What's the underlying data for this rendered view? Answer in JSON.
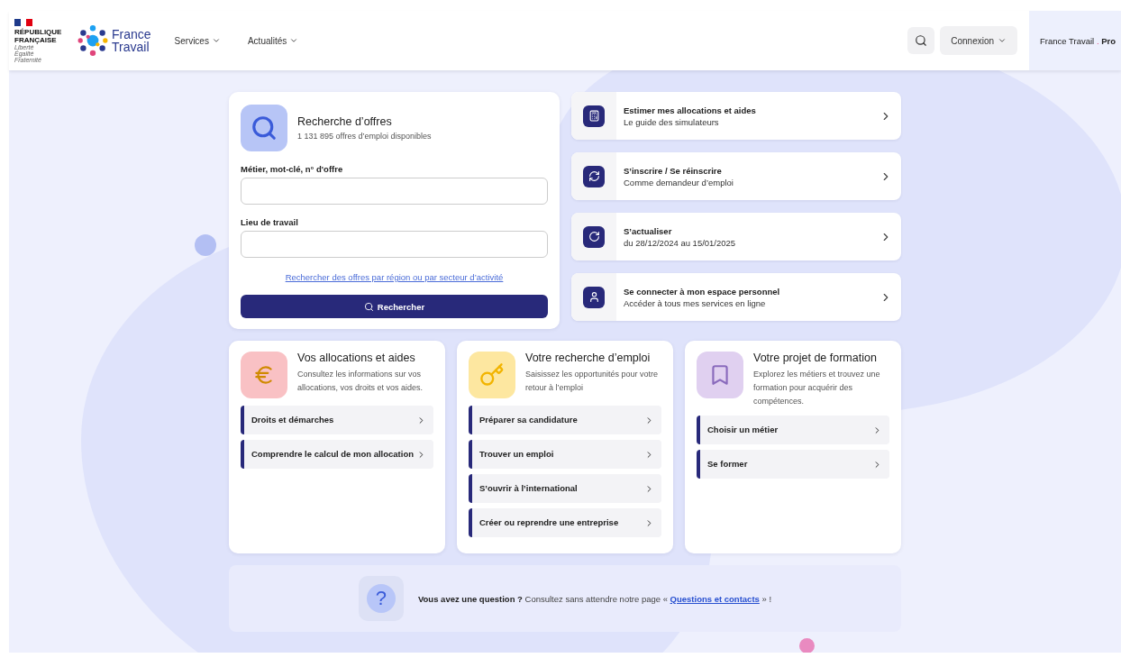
{
  "header": {
    "republic": {
      "line1": "RÉPUBLIQUE",
      "line2": "FRANÇAISE",
      "motto": [
        "Liberté",
        "Égalité",
        "Fraternité"
      ]
    },
    "brand": {
      "line1": "France",
      "line2": "Travail"
    },
    "nav": [
      {
        "label": "Services"
      },
      {
        "label": "Actualités"
      }
    ],
    "login": {
      "label": "Connexion"
    },
    "pro": {
      "name": "France Travail",
      "separator": ".",
      "suffix": "Pro"
    }
  },
  "search_card": {
    "title": "Recherche d’offres",
    "subtitle": "1 131 895 offres d’emploi disponibles",
    "fields": [
      {
        "label": "Métier, mot-clé, n° d'offre"
      },
      {
        "label": "Lieu de travail"
      }
    ],
    "link": "Rechercher des offres par région ou par secteur d’activité",
    "button": "Rechercher"
  },
  "services": [
    {
      "title": "Estimer mes allocations et aides",
      "subtitle": "Le guide des simulateurs"
    },
    {
      "title": "S’inscrire / Se réinscrire",
      "subtitle": "Comme demandeur d’emploi"
    },
    {
      "title": "S’actualiser",
      "subtitle": "du 28/12/2024 au 15/01/2025"
    },
    {
      "title": "Se connecter à mon espace personnel",
      "subtitle": "Accéder à tous mes services en ligne"
    }
  ],
  "themes": [
    {
      "title": "Vos allocations et aides",
      "text": "Consultez les informations sur vos allocations, vos droits et vos aides.",
      "links": [
        "Droits et démarches",
        "Comprendre le calcul de mon allocation"
      ]
    },
    {
      "title": "Votre recherche d’emploi",
      "text": "Saisissez les opportunités pour votre retour à l’emploi",
      "links": [
        "Préparer sa candidature",
        "Trouver un emploi",
        "S’ouvrir à l’international",
        "Créer ou reprendre une entreprise"
      ]
    },
    {
      "title": "Votre projet de formation",
      "text": "Explorez les métiers et trouvez une formation pour acquérir des compétences.",
      "links": [
        "Choisir un métier",
        "Se former"
      ]
    }
  ],
  "question": {
    "text": "**Vous avez une question ?** Consultez sans attendre notre page « ",
    "link": "Questions et contacts",
    "after": " » !",
    "icon": "?"
  }
}
